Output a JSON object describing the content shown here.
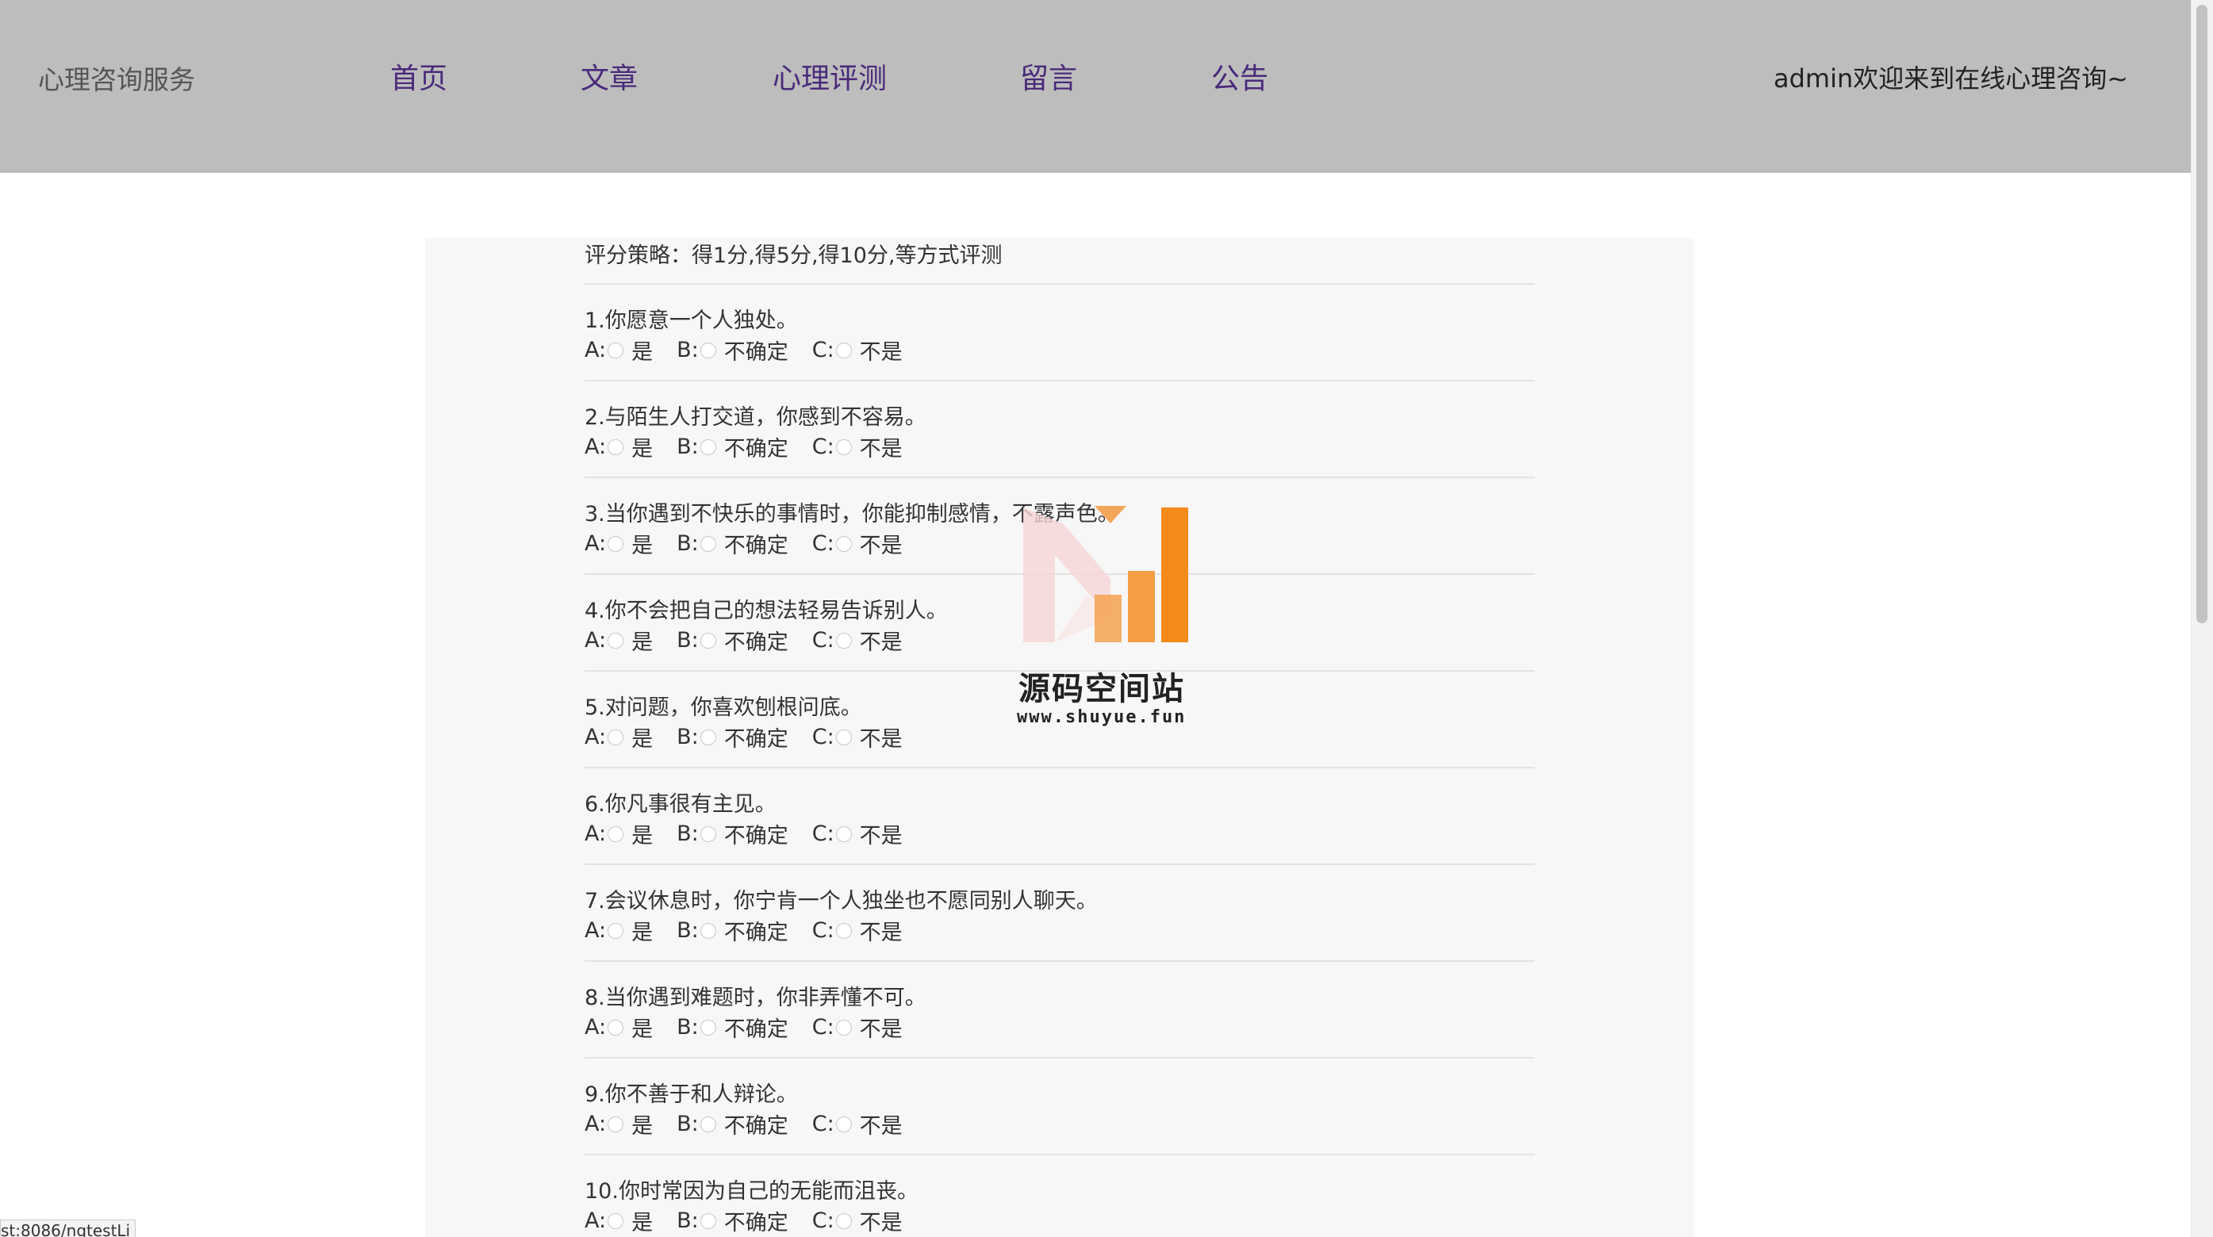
{
  "header": {
    "brand": "心理咨询服务",
    "nav": [
      "首页",
      "文章",
      "心理评测",
      "留言",
      "公告"
    ],
    "welcome": "admin欢迎来到在线心理咨询~"
  },
  "strategy": "评分策略：得1分,得5分,得10分,等方式评测",
  "option_labels": {
    "a": "A:",
    "b": "B:",
    "c": "C:"
  },
  "option_texts": {
    "a": "是",
    "b": "不确定",
    "c": "不是"
  },
  "questions": [
    "1.你愿意一个人独处。",
    "2.与陌生人打交道，你感到不容易。",
    "3.当你遇到不快乐的事情时，你能抑制感情，不露声色。",
    "4.你不会把自己的想法轻易告诉别人。",
    "5.对问题，你喜欢刨根问底。",
    "6.你凡事很有主见。",
    "7.会议休息时，你宁肯一个人独坐也不愿同别人聊天。",
    "8.当你遇到难题时，你非弄懂不可。",
    "9.你不善于和人辩论。",
    "10.你时常因为自己的无能而沮丧。"
  ],
  "watermark": {
    "title": "源码空间站",
    "url": "www.shuyue.fun"
  },
  "status_url": "st:8086/ngtestLi",
  "colors": {
    "header_bg": "#bdbdbd",
    "nav_link": "#4a2a7a",
    "panel_bg": "#f7f7f7"
  }
}
